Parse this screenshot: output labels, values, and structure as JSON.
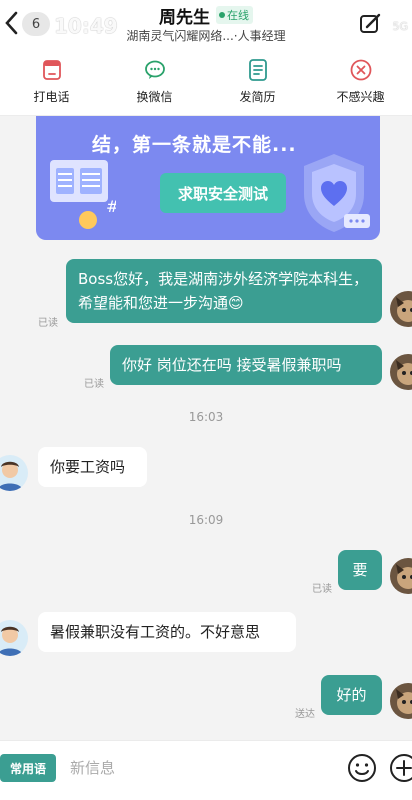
{
  "header": {
    "unread_count": "6",
    "time": "10:49",
    "name": "周先生",
    "online_label": "在线",
    "subtitle": "湖南灵气闪耀网络...·人事经理",
    "network": "5G"
  },
  "actions": [
    {
      "label": "打电话",
      "icon": "phone-icon"
    },
    {
      "label": "换微信",
      "icon": "wechat-icon"
    },
    {
      "label": "发简历",
      "icon": "resume-icon"
    },
    {
      "label": "不感兴趣",
      "icon": "not-interested-icon"
    }
  ],
  "banner": {
    "text": "结，第一条就是不能...",
    "button": "求职安全测试"
  },
  "messages": {
    "m1": {
      "text": "Boss您好，我是湖南涉外经济学院本科生，希望能和您进一步沟通😊",
      "status": "已读"
    },
    "m2": {
      "text": "你好 岗位还在吗 接受暑假兼职吗",
      "status": "已读"
    },
    "ts1": "16:03",
    "m3": {
      "text": "你要工资吗"
    },
    "ts2": "16:09",
    "m4": {
      "text": "要",
      "status": "已读"
    },
    "m5": {
      "text": "暑假兼职没有工资的。不好意思"
    },
    "m6": {
      "text": "好的",
      "status": "送达"
    }
  },
  "input": {
    "phrases_label": "常用语",
    "placeholder": "新信息"
  },
  "colors": {
    "accent": "#3b9e92",
    "banner": "#7c89f0",
    "online": "#2aa26b"
  }
}
